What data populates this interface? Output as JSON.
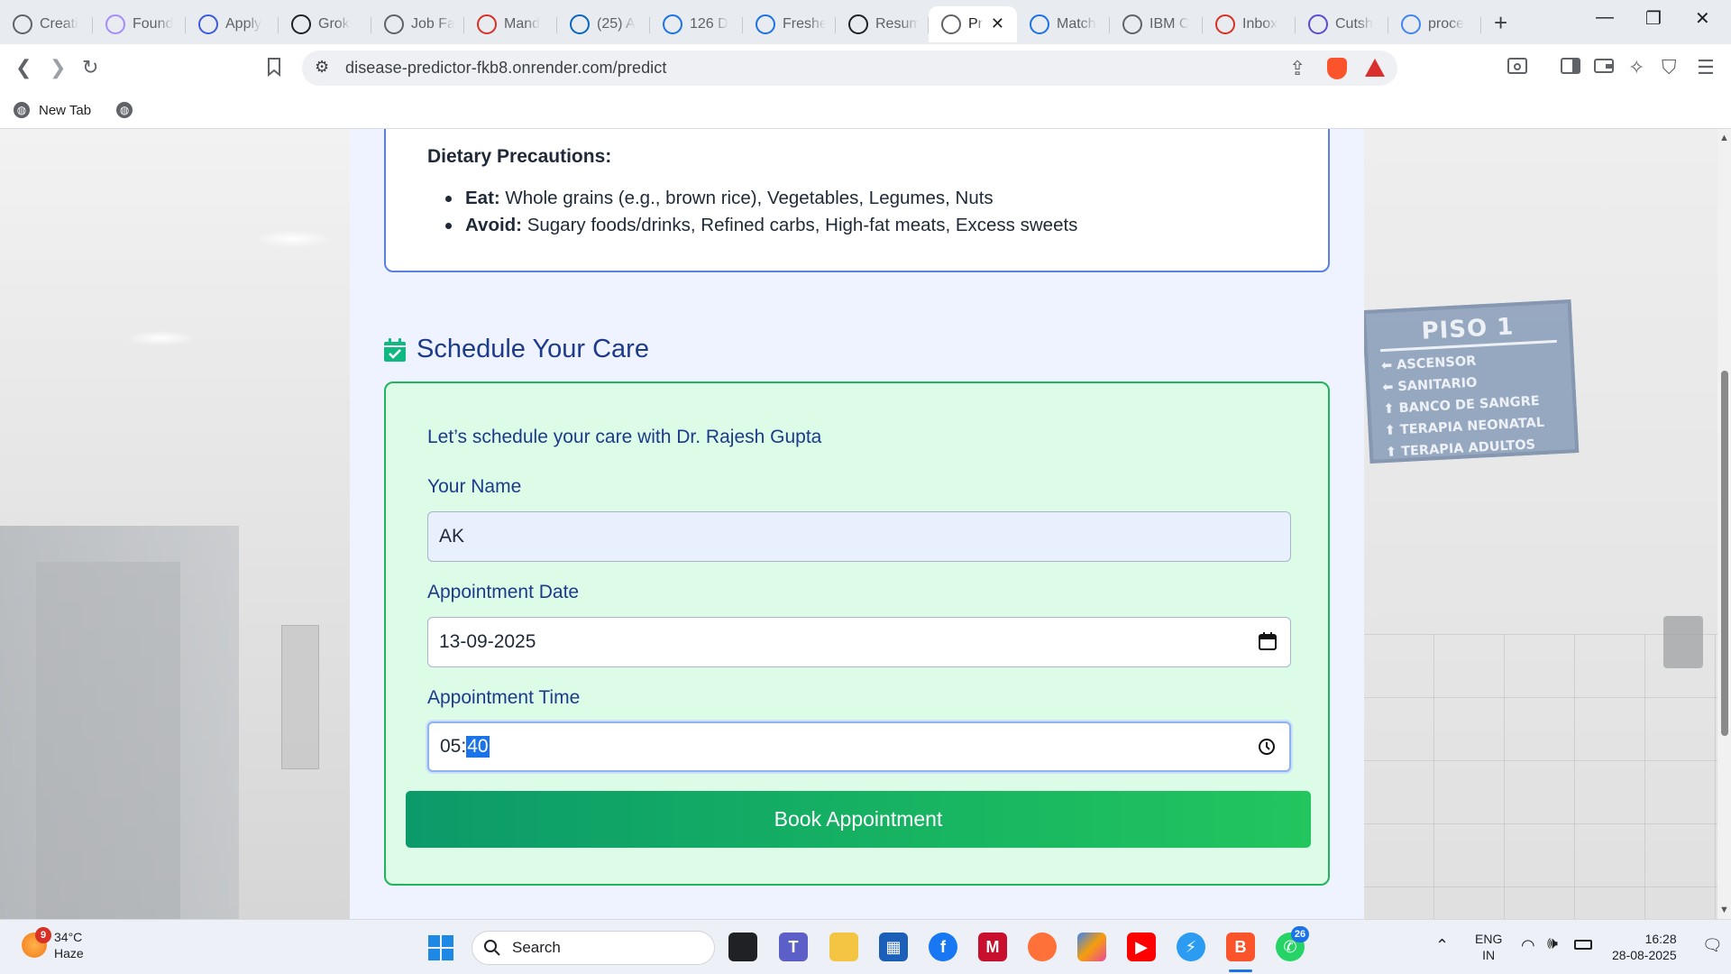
{
  "browser": {
    "tabs": [
      {
        "title": "Creati",
        "icon": "openai-icon",
        "color": "#5f6368"
      },
      {
        "title": "Found",
        "icon": "perplexity-icon",
        "color": "#a78bfa"
      },
      {
        "title": "Apply",
        "icon": "apply-icon",
        "color": "#3b5bdb"
      },
      {
        "title": "Grok",
        "icon": "grok-icon",
        "color": "#202124"
      },
      {
        "title": "Job Fa",
        "icon": "job-icon",
        "color": "#5f6368"
      },
      {
        "title": "Mand",
        "icon": "gmail-icon",
        "color": "#d93025"
      },
      {
        "title": "(25) A",
        "icon": "linkedin-icon",
        "color": "#0a66c2"
      },
      {
        "title": "126 D",
        "icon": "s-icon",
        "color": "#1a73e8"
      },
      {
        "title": "Freshe",
        "icon": "freshersworld-icon",
        "color": "#1a73e8"
      },
      {
        "title": "Resum",
        "icon": "chatgpt-icon",
        "color": "#202124"
      },
      {
        "title": "Pr",
        "icon": "globe-icon",
        "color": "#5f6368",
        "active": true
      },
      {
        "title": "Match",
        "icon": "match-icon",
        "color": "#1a73e8"
      },
      {
        "title": "IBM C",
        "icon": "ibm-icon",
        "color": "#5f6368"
      },
      {
        "title": "Inbox",
        "icon": "gmail-icon",
        "color": "#d93025"
      },
      {
        "title": "Cutsh",
        "icon": "cutshort-icon",
        "color": "#5b4bd5"
      },
      {
        "title": "proce",
        "icon": "google-icon",
        "color": "#4285f4"
      }
    ],
    "url": "disease-predictor-fkb8.onrender.com/predict",
    "bookmarks": [
      {
        "label": "New Tab"
      }
    ]
  },
  "precautions": {
    "title": "Dietary Precautions:",
    "items": [
      {
        "label": "Eat:",
        "text": " Whole grains (e.g., brown rice), Vegetables, Legumes, Nuts"
      },
      {
        "label": "Avoid:",
        "text": " Sugary foods/drinks, Refined carbs, High-fat meats, Excess sweets"
      }
    ]
  },
  "schedule": {
    "heading": "Schedule Your Care",
    "intro": "Let’s schedule your care with Dr. Rajesh Gupta",
    "name_label": "Your Name",
    "name_value": "AK",
    "date_label": "Appointment Date",
    "date_value": "13-09-2025",
    "time_label": "Appointment Time",
    "time_hours": "05:",
    "time_minutes": "40",
    "book_button": "Book Appointment"
  },
  "background_sign": {
    "title": "PISO 1",
    "lines": [
      "ASCENSOR",
      "SANITARIO",
      "BANCO DE SANGRE",
      "TERAPIA NEONATAL",
      "TERAPIA ADULTOS"
    ]
  },
  "taskbar": {
    "weather_temp": "34°C",
    "weather_desc": "Haze",
    "weather_badge": "9",
    "search_placeholder": "Search",
    "whatsapp_badge": "26",
    "lang_top": "ENG",
    "lang_bottom": "IN",
    "time": "16:28",
    "date": "28-08-2025"
  }
}
